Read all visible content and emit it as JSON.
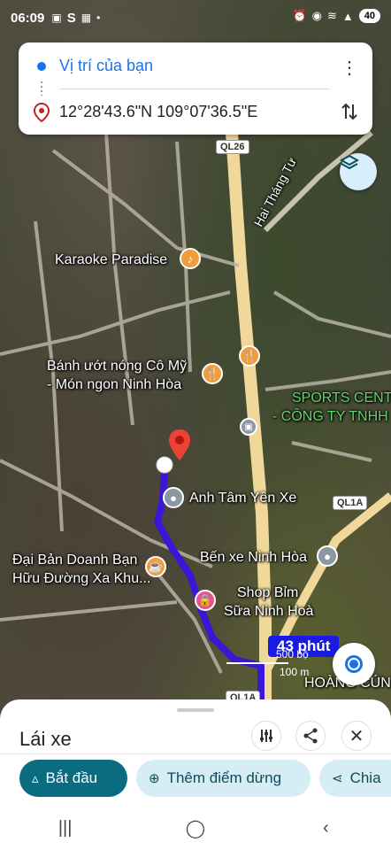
{
  "status_bar": {
    "time": "06:09",
    "battery": "40"
  },
  "route": {
    "origin": "Vị trí của bạn",
    "destination": "12°28'43.6\"N 109°07'36.5\"E"
  },
  "map": {
    "road_shields": [
      "QL26",
      "QL1A",
      "QL1A"
    ],
    "street_label": "Hai Tháng Tư",
    "places": [
      "Karaoke Paradise",
      "Bánh ướt nóng Cô Mỹ",
      "- Món ngon Ninh Hòa",
      "SPORTS CENT",
      "- CÔNG TY TNHH",
      "Anh Tâm Yên Xe",
      "Bến xe Ninh Hòa",
      "Đại Bản Doanh Bạn",
      "Hữu Đường Xa Khu...",
      "Shop Bỉm",
      "Sữa Ninh Hoà",
      "HOÀNG CÚN"
    ],
    "eta": "43 phút",
    "scale": [
      "500 bộ",
      "100 m"
    ]
  },
  "sheet": {
    "mode": "Lái xe",
    "start_label": "Bắt đầu",
    "add_stop_label": "Thêm điểm dừng",
    "share_label": "Chia"
  },
  "colors": {
    "route": "#3b16d8",
    "accent": "#0b6b80",
    "chip": "#d6edf5"
  }
}
